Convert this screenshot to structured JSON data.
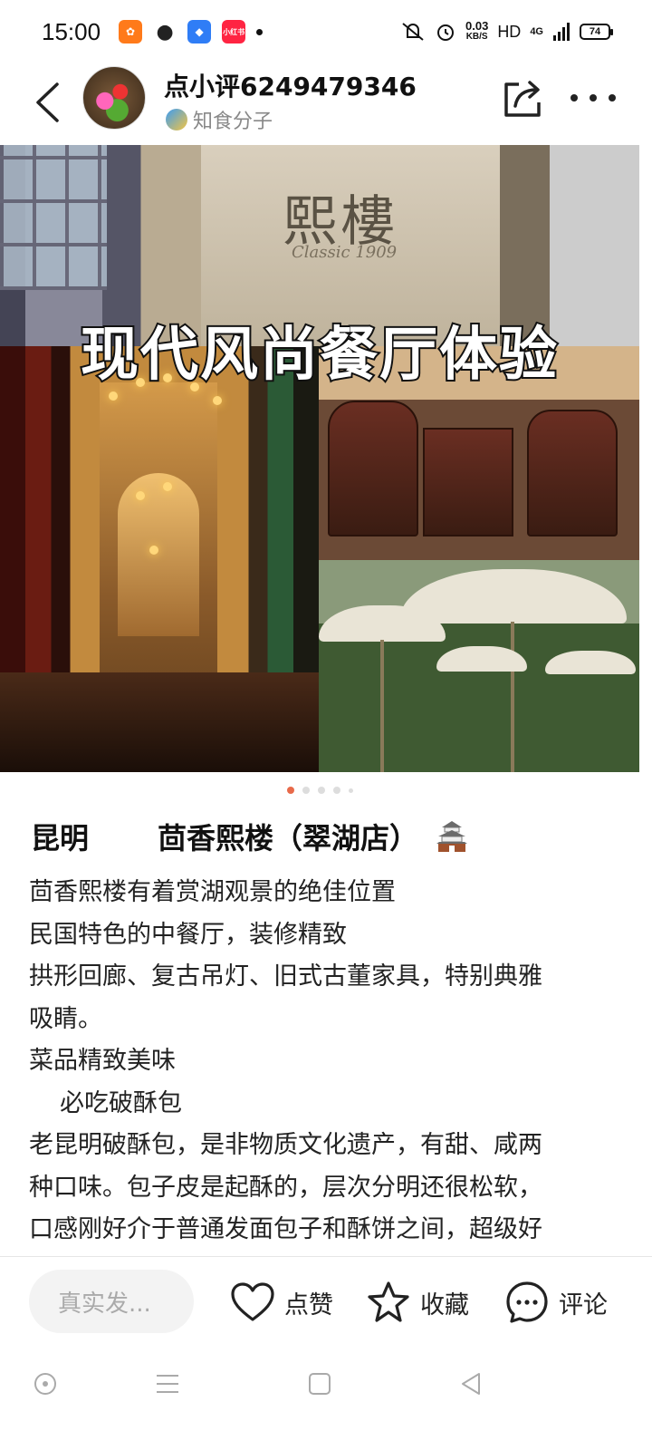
{
  "status_bar": {
    "time": "15:00",
    "apps": [
      {
        "name": "taobao-app-icon",
        "color": "#ff7a1a",
        "glyph": "✿"
      },
      {
        "name": "wechat-app-icon",
        "color": "#222222",
        "glyph": "●"
      },
      {
        "name": "notes-app-icon",
        "color": "#2f7df6",
        "glyph": "◆"
      },
      {
        "name": "xiaohongshu-app-icon",
        "color": "#ff2442",
        "glyph": "小红书"
      }
    ],
    "net_speed_value": "0.03",
    "net_speed_unit": "KB/S",
    "hd": "HD",
    "signal": "4G",
    "battery": "74"
  },
  "header": {
    "user_name": "点小评6249479346",
    "user_tag": "知食分子"
  },
  "photo": {
    "sign_text": "熙樓",
    "sign_subtext": "Classic 1909",
    "overlay_title": "现代风尚餐厅体验",
    "page_count": 5,
    "current_page": 1
  },
  "post": {
    "city": "昆明",
    "restaurant": "茴香熙楼（翠湖店）",
    "lines": [
      "茴香熙楼有着赏湖观景的绝佳位置",
      "民国特色的中餐厅，装修精致",
      "拱形回廊、复古吊灯、旧式古董家具，特别典雅",
      "吸睛。",
      "菜品精致美味",
      "必吃破酥包",
      "老昆明破酥包，是非物质文化遗产，有甜、咸两",
      "种口味。包子皮是起酥的，层次分明还很松软，",
      "口感刚好介于普通发面包子和酥饼之间，超级好"
    ]
  },
  "action_bar": {
    "input_placeholder": "真实发...",
    "like_label": "点赞",
    "collect_label": "收藏",
    "comment_label": "评论"
  },
  "colors": {
    "accent": "#e86a4a",
    "text": "#222222",
    "muted": "#888888"
  }
}
